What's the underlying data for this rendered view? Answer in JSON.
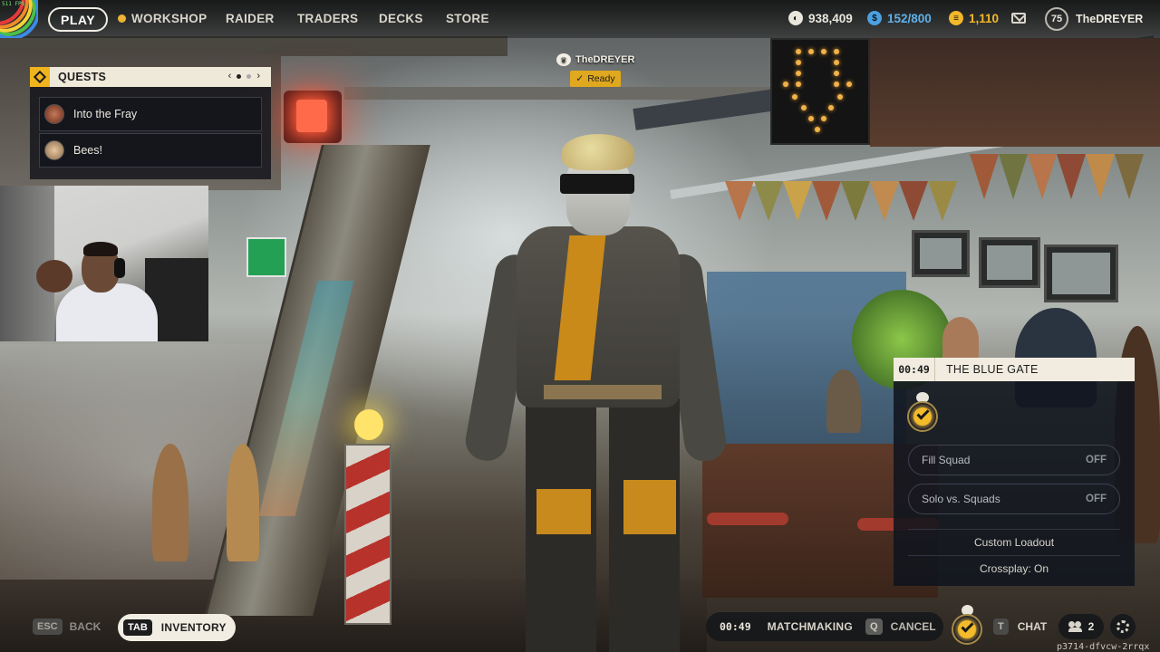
{
  "hud": {
    "fps": "511 FPS"
  },
  "nav": {
    "play": "PLAY",
    "items": [
      "WORKSHOP",
      "RAIDER",
      "TRADERS",
      "DECKS",
      "STORE"
    ]
  },
  "currencies": [
    {
      "icon": "coin-icon",
      "value": "938,409"
    },
    {
      "icon": "raider-token-icon",
      "value": "152/800"
    },
    {
      "icon": "credits-icon",
      "value": "1,110"
    }
  ],
  "profile": {
    "level": "75",
    "username": "TheDREYER"
  },
  "quests": {
    "title": "QUESTS",
    "pager": {
      "prev": "‹",
      "next": "›"
    },
    "items": [
      {
        "label": "Into the Fray",
        "avatar_color": "#8a4a3a"
      },
      {
        "label": "Bees!",
        "avatar_color": "#b78a5a"
      }
    ]
  },
  "player_tag": {
    "name": "TheDREYER",
    "status": "Ready"
  },
  "map_panel": {
    "timer": "00:49",
    "map_name": "THE BLUE GATE",
    "toggles": [
      {
        "label": "Fill Squad",
        "value": "OFF"
      },
      {
        "label": "Solo vs. Squads",
        "value": "OFF"
      }
    ],
    "custom_loadout": "Custom Loadout",
    "crossplay": "Crossplay: On"
  },
  "bottom": {
    "back": {
      "key": "ESC",
      "label": "BACK"
    },
    "inventory": {
      "key": "TAB",
      "label": "INVENTORY"
    },
    "matchmaking": {
      "timer": "00:49",
      "label": "MATCHMAKING",
      "key": "Q",
      "cancel": "CANCEL"
    },
    "chat": {
      "key": "T",
      "label": "CHAT"
    },
    "friends_count": "2",
    "session_id": "p3714-dfvcw-2rrqx"
  },
  "colors": {
    "accent_gold": "#efb41d",
    "panel_cream": "#efe9da",
    "panel_dark": "#14161c"
  }
}
